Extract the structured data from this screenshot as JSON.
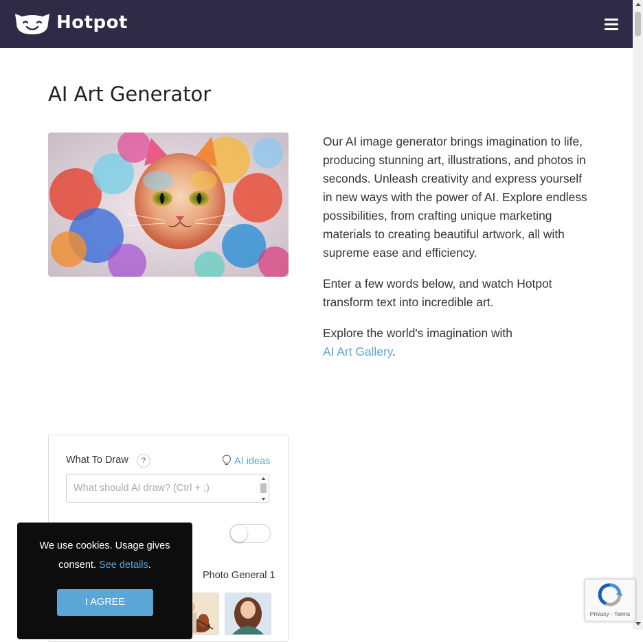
{
  "header": {
    "brand": "Hotpot",
    "logo_icon": "cat-face-logo-icon",
    "menu_icon": "hamburger-menu-icon",
    "background": "#2f2a45"
  },
  "page": {
    "title": "AI Art Generator",
    "hero_image": "colorful-smoke-cat-image"
  },
  "intro": {
    "p1": "Our AI image generator brings imagination to life, producing stunning art, illustrations, and photos in seconds. Unleash creativity and express yourself in new ways with the power of AI. Explore endless possibilities, from crafting unique marketing materials to creating beautiful artwork, all with supreme ease and efficiency.",
    "p2": "Enter a few words below, and watch Hotpot transform text into incredible art.",
    "p3_prefix": "Explore the world's imagination with",
    "gallery_link": "AI Art Gallery",
    "p3_suffix": "."
  },
  "form": {
    "what_label": "What To Draw",
    "help_label": "?",
    "ideas_label": "AI ideas",
    "ideas_icon": "lightbulb-icon",
    "prompt_placeholder": "What should AI draw? (Ctrl + ;)",
    "toggle_on": false,
    "style_name": "Photo General 1"
  },
  "cookie": {
    "message": "We use cookies. Usage gives consent.",
    "details_link": "See details",
    "details_suffix": ".",
    "agree_label": "I AGREE"
  },
  "recaptcha": {
    "terms": "Privacy - Terms"
  },
  "colors": {
    "accent": "#5aa6d6",
    "header": "#2f2a45",
    "cookie_bg": "#0d0d0d"
  }
}
